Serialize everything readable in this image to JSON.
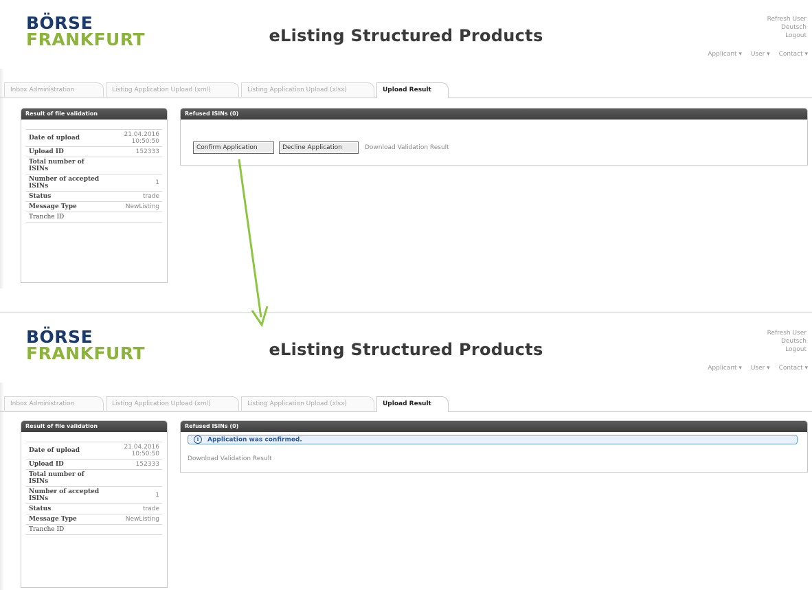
{
  "logo": {
    "line1": "BÖRSE",
    "line2": "FRANKFURT"
  },
  "app_title": "eListing Structured Products",
  "colors": {
    "logo_navy": "#1a3a6b",
    "logo_green": "#8cb33a",
    "arrow_green": "#8cc641",
    "panel_header": "#4a4a4a",
    "notice_blue": "#2d5ba0"
  },
  "before": {
    "user_links": [
      "Refresh User",
      "Deutsch",
      "Logout"
    ],
    "top_nav": [
      "Applicant ▾",
      "User ▾",
      "Contact ▾"
    ],
    "tabs": [
      "Inbox Administration",
      "Listing Application Upload (xml)",
      "Listing Application Upload (xlsx)",
      "Upload Result"
    ],
    "left_panel": {
      "title": "Result of file validation",
      "rows": [
        {
          "key": "Date of upload",
          "value": "21.04.2016 10:50:50"
        },
        {
          "key": "Upload ID",
          "value": "152333"
        },
        {
          "key": "Total number of ISINs",
          "value": ""
        },
        {
          "key": "Number of accepted ISINs",
          "value": "1"
        },
        {
          "key": "Status",
          "value": "trade"
        },
        {
          "key": "Message Type",
          "value": "NewListing"
        },
        {
          "key": "Tranche ID",
          "value": ""
        }
      ]
    },
    "right_panel": {
      "title": "Refused ISINs (0)",
      "confirm_button": "Confirm Application",
      "decline_button": "Decline Application",
      "download_link": "Download Validation Result"
    }
  },
  "after": {
    "user_links": [
      "Refresh User",
      "Deutsch",
      "Logout"
    ],
    "top_nav": [
      "Applicant ▾",
      "User ▾",
      "Contact ▾"
    ],
    "tabs": [
      "Inbox Administration",
      "Listing Application Upload (xml)",
      "Listing Application Upload (xlsx)",
      "Upload Result"
    ],
    "left_panel": {
      "title": "Result of file validation",
      "rows": [
        {
          "key": "Date of upload",
          "value": "21.04.2016 10:50:50"
        },
        {
          "key": "Upload ID",
          "value": "152333"
        },
        {
          "key": "Total number of ISINs",
          "value": ""
        },
        {
          "key": "Number of accepted ISINs",
          "value": "1"
        },
        {
          "key": "Status",
          "value": "trade"
        },
        {
          "key": "Message Type",
          "value": "NewListing"
        },
        {
          "key": "Tranche ID",
          "value": ""
        }
      ]
    },
    "right_panel": {
      "title": "Refused ISINs (0)",
      "notice_icon": "info-icon",
      "notice_text": "Application was confirmed.",
      "download_link": "Download Validation Result"
    }
  }
}
